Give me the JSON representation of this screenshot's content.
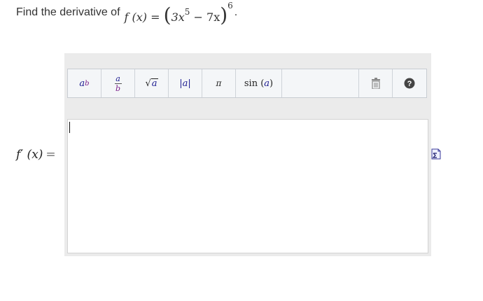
{
  "question": {
    "prompt": "Find the derivative of",
    "function_lhs": "f (x) =",
    "base_coef": "3x",
    "base_exp": "5",
    "minus_term": "− 7x",
    "outer_exp": "6",
    "period": "."
  },
  "toolbar": {
    "power_base": "a",
    "power_exp": "b",
    "frac_num": "a",
    "frac_den": "b",
    "sqrt_arg": "a",
    "abs_label": "|a|",
    "pi_label": "π",
    "sin_label": "sin",
    "sin_arg": "a",
    "help_label": "?"
  },
  "answer": {
    "label": "f′ (x)",
    "equals": "=",
    "value": ""
  },
  "colors": {
    "var_a": "#1a1a8f",
    "var_b": "#7a1f8a",
    "help_bg": "#444444"
  }
}
